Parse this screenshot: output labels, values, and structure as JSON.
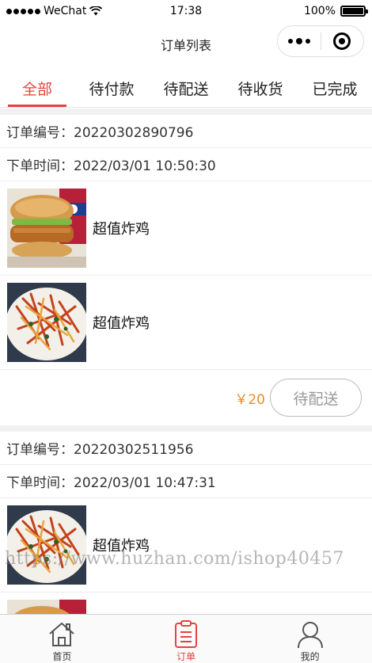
{
  "status_bar": {
    "carrier": "WeChat",
    "time": "17:38",
    "battery": "100%"
  },
  "nav": {
    "title": "订单列表"
  },
  "tabs": [
    {
      "label": "全部",
      "active": true
    },
    {
      "label": "待付款",
      "active": false
    },
    {
      "label": "待配送",
      "active": false
    },
    {
      "label": "待收货",
      "active": false
    },
    {
      "label": "已完成",
      "active": false
    }
  ],
  "orders": [
    {
      "number": "订单编号：20220302890796",
      "time": "下单时间：2022/03/01 10:50:30",
      "items": [
        {
          "name": "超值炸鸡",
          "image": "burger-image"
        },
        {
          "name": "超值炸鸡",
          "image": "fries-image"
        }
      ],
      "price": "￥20",
      "status": "待配送"
    },
    {
      "number": "订单编号：20220302511956",
      "time": "下单时间：2022/03/01 10:47:31",
      "items": [
        {
          "name": "超值炸鸡",
          "image": "fries-image"
        },
        {
          "name": "",
          "image": "burger-image"
        }
      ]
    }
  ],
  "watermark": "https://www.huzhan.com/ishop40457",
  "tab_bar": [
    {
      "label": "首页",
      "icon": "home-icon",
      "active": false
    },
    {
      "label": "订单",
      "icon": "order-icon",
      "active": true
    },
    {
      "label": "我的",
      "icon": "user-icon",
      "active": false
    }
  ],
  "colors": {
    "accent": "#e8413d",
    "price": "#f08a1d"
  }
}
